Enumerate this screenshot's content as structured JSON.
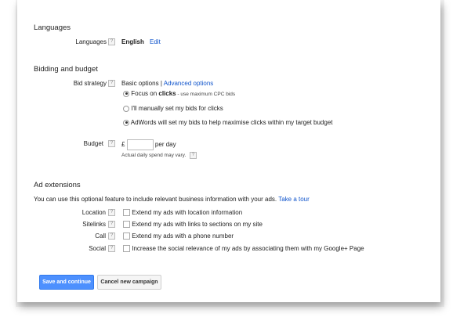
{
  "languages": {
    "heading": "Languages",
    "label": "Languages",
    "value": "English",
    "edit": "Edit"
  },
  "bidding": {
    "heading": "Bidding and budget",
    "bid_strategy_label": "Bid strategy",
    "basic_options": "Basic options",
    "separator": "|",
    "advanced_options": "Advanced options",
    "options": [
      {
        "prefix": "Focus on ",
        "bold": "clicks",
        "suffix": " - use maximum CPC bids",
        "selected": true
      },
      {
        "text": "I'll manually set my bids for clicks",
        "selected": false
      },
      {
        "text": "AdWords will set my bids to help maximise clicks within my target budget",
        "selected": true
      }
    ],
    "budget_label": "Budget",
    "currency": "£",
    "budget_value": "",
    "per_day": "per day",
    "budget_note": "Actual daily spend may vary."
  },
  "ad_extensions": {
    "heading": "Ad extensions",
    "intro": "You can use this optional feature to include relevant business information with your ads.",
    "take_tour": "Take a tour",
    "items": [
      {
        "label": "Location",
        "text": "Extend my ads with location information",
        "checked": false
      },
      {
        "label": "Sitelinks",
        "text": "Extend my ads with links to sections on my site",
        "checked": false
      },
      {
        "label": "Call",
        "text": "Extend my ads with a phone number",
        "checked": false
      },
      {
        "label": "Social",
        "text": "Increase the social relevance of my ads by associating them with my Google+ Page",
        "checked": false
      }
    ]
  },
  "help_glyph": "?",
  "buttons": {
    "save": "Save and continue",
    "cancel": "Cancel new campaign"
  }
}
